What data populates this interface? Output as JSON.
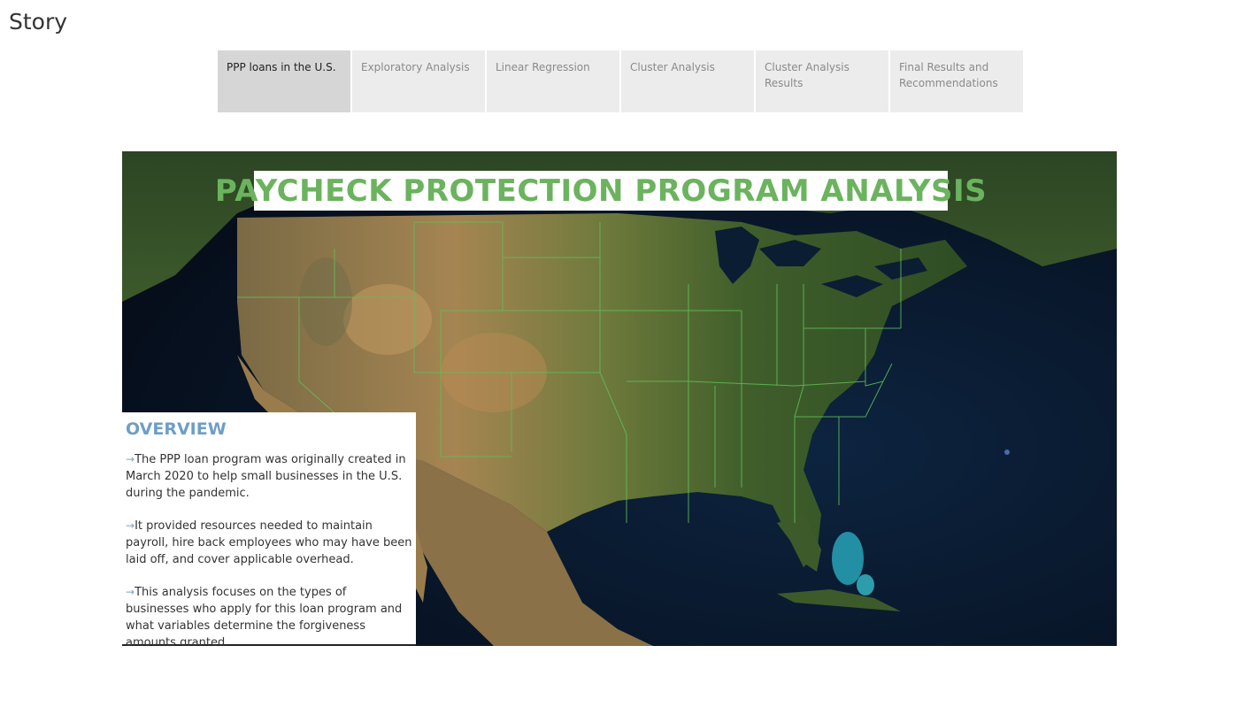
{
  "story": {
    "title": "Story"
  },
  "tabs": [
    {
      "label": "PPP loans in the U.S.",
      "active": true
    },
    {
      "label": "Exploratory Analysis",
      "active": false
    },
    {
      "label": "Linear Regression",
      "active": false
    },
    {
      "label": "Cluster Analysis",
      "active": false
    },
    {
      "label": "Cluster Analysis Results",
      "active": false
    },
    {
      "label": "Final Results and Recommendations",
      "active": false
    }
  ],
  "dashboard": {
    "headline": "PAYCHECK PROTECTION PROGRAM ANALYSIS",
    "overview": {
      "heading": "OVERVIEW",
      "bullet_icon": "arrow-right-icon",
      "paragraphs": [
        "The PPP loan program was originally created in March 2020 to help small businesses in the U.S. during the pandemic.",
        "It provided resources needed to maintain payroll, hire back employees who may have been laid off, and cover applicable overhead.",
        "This analysis focuses on the types of businesses who apply for this loan program and what variables determine the forgiveness amounts granted."
      ]
    },
    "map_style": "satellite",
    "colors": {
      "headline": "#6bb35e",
      "overview_heading": "#6e9ec6",
      "state_borders": "#5fbf5a"
    }
  }
}
